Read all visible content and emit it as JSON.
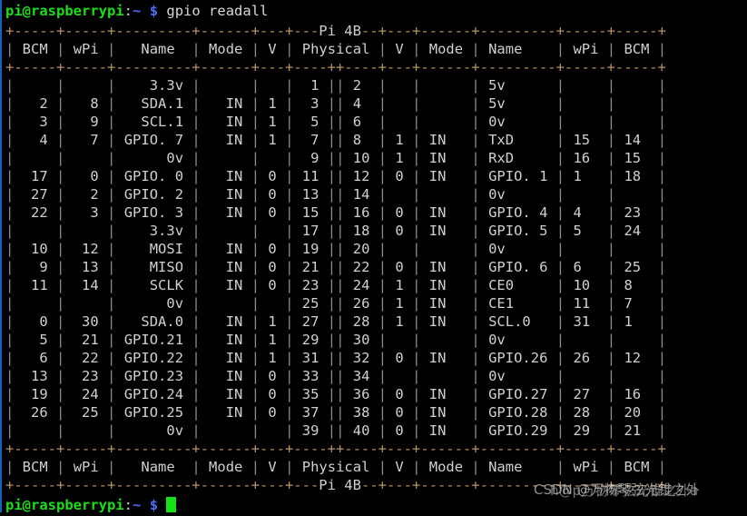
{
  "terminal": {
    "prompt": {
      "user_host": "pi@raspberrypi",
      "colon": ":",
      "path": "~",
      "dollar": "$"
    },
    "command": "gpio readall",
    "watermark": "CSDN @万物琴弦光锥之外",
    "watermark_overlay": "h@p万物琴弦光锥之外a"
  },
  "table": {
    "board_label": "Pi 4B",
    "border_top": "+-----+-----+---------+------+---+---Pi 4B--+---+------+---------+-----+-----+",
    "border_mid": "+-----+-----+---------+------+---+----++----+---+------+---------+-----+-----+",
    "border_bottom": "+-----+-----+---------+------+---+---Pi 4B--+---+------+---------+-----+-----+",
    "header_line": "| BCM | wPi |   Name  | Mode | V | Physical | V | Mode | Name    | wPi | BCM |",
    "headers": [
      "BCM",
      "wPi",
      "Name",
      "Mode",
      "V",
      "Physical",
      "V",
      "Mode",
      "Name",
      "wPi",
      "BCM"
    ],
    "rows": [
      {
        "bcm_l": "",
        "wpi_l": "",
        "name_l": "3.3v",
        "mode_l": "",
        "v_l": "",
        "phys_l": "1",
        "phys_r": "2",
        "v_r": "",
        "mode_r": "",
        "name_r": "5v",
        "wpi_r": "",
        "bcm_r": ""
      },
      {
        "bcm_l": "2",
        "wpi_l": "8",
        "name_l": "SDA.1",
        "mode_l": "IN",
        "v_l": "1",
        "phys_l": "3",
        "phys_r": "4",
        "v_r": "",
        "mode_r": "",
        "name_r": "5v",
        "wpi_r": "",
        "bcm_r": ""
      },
      {
        "bcm_l": "3",
        "wpi_l": "9",
        "name_l": "SCL.1",
        "mode_l": "IN",
        "v_l": "1",
        "phys_l": "5",
        "phys_r": "6",
        "v_r": "",
        "mode_r": "",
        "name_r": "0v",
        "wpi_r": "",
        "bcm_r": ""
      },
      {
        "bcm_l": "4",
        "wpi_l": "7",
        "name_l": "GPIO. 7",
        "mode_l": "IN",
        "v_l": "1",
        "phys_l": "7",
        "phys_r": "8",
        "v_r": "1",
        "mode_r": "IN",
        "name_r": "TxD",
        "wpi_r": "15",
        "bcm_r": "14"
      },
      {
        "bcm_l": "",
        "wpi_l": "",
        "name_l": "0v",
        "mode_l": "",
        "v_l": "",
        "phys_l": "9",
        "phys_r": "10",
        "v_r": "1",
        "mode_r": "IN",
        "name_r": "RxD",
        "wpi_r": "16",
        "bcm_r": "15"
      },
      {
        "bcm_l": "17",
        "wpi_l": "0",
        "name_l": "GPIO. 0",
        "mode_l": "IN",
        "v_l": "0",
        "phys_l": "11",
        "phys_r": "12",
        "v_r": "0",
        "mode_r": "IN",
        "name_r": "GPIO. 1",
        "wpi_r": "1",
        "bcm_r": "18"
      },
      {
        "bcm_l": "27",
        "wpi_l": "2",
        "name_l": "GPIO. 2",
        "mode_l": "IN",
        "v_l": "0",
        "phys_l": "13",
        "phys_r": "14",
        "v_r": "",
        "mode_r": "",
        "name_r": "0v",
        "wpi_r": "",
        "bcm_r": ""
      },
      {
        "bcm_l": "22",
        "wpi_l": "3",
        "name_l": "GPIO. 3",
        "mode_l": "IN",
        "v_l": "0",
        "phys_l": "15",
        "phys_r": "16",
        "v_r": "0",
        "mode_r": "IN",
        "name_r": "GPIO. 4",
        "wpi_r": "4",
        "bcm_r": "23"
      },
      {
        "bcm_l": "",
        "wpi_l": "",
        "name_l": "3.3v",
        "mode_l": "",
        "v_l": "",
        "phys_l": "17",
        "phys_r": "18",
        "v_r": "0",
        "mode_r": "IN",
        "name_r": "GPIO. 5",
        "wpi_r": "5",
        "bcm_r": "24"
      },
      {
        "bcm_l": "10",
        "wpi_l": "12",
        "name_l": "MOSI",
        "mode_l": "IN",
        "v_l": "0",
        "phys_l": "19",
        "phys_r": "20",
        "v_r": "",
        "mode_r": "",
        "name_r": "0v",
        "wpi_r": "",
        "bcm_r": ""
      },
      {
        "bcm_l": "9",
        "wpi_l": "13",
        "name_l": "MISO",
        "mode_l": "IN",
        "v_l": "0",
        "phys_l": "21",
        "phys_r": "22",
        "v_r": "0",
        "mode_r": "IN",
        "name_r": "GPIO. 6",
        "wpi_r": "6",
        "bcm_r": "25"
      },
      {
        "bcm_l": "11",
        "wpi_l": "14",
        "name_l": "SCLK",
        "mode_l": "IN",
        "v_l": "0",
        "phys_l": "23",
        "phys_r": "24",
        "v_r": "1",
        "mode_r": "IN",
        "name_r": "CE0",
        "wpi_r": "10",
        "bcm_r": "8"
      },
      {
        "bcm_l": "",
        "wpi_l": "",
        "name_l": "0v",
        "mode_l": "",
        "v_l": "",
        "phys_l": "25",
        "phys_r": "26",
        "v_r": "1",
        "mode_r": "IN",
        "name_r": "CE1",
        "wpi_r": "11",
        "bcm_r": "7"
      },
      {
        "bcm_l": "0",
        "wpi_l": "30",
        "name_l": "SDA.0",
        "mode_l": "IN",
        "v_l": "1",
        "phys_l": "27",
        "phys_r": "28",
        "v_r": "1",
        "mode_r": "IN",
        "name_r": "SCL.0",
        "wpi_r": "31",
        "bcm_r": "1"
      },
      {
        "bcm_l": "5",
        "wpi_l": "21",
        "name_l": "GPIO.21",
        "mode_l": "IN",
        "v_l": "1",
        "phys_l": "29",
        "phys_r": "30",
        "v_r": "",
        "mode_r": "",
        "name_r": "0v",
        "wpi_r": "",
        "bcm_r": ""
      },
      {
        "bcm_l": "6",
        "wpi_l": "22",
        "name_l": "GPIO.22",
        "mode_l": "IN",
        "v_l": "1",
        "phys_l": "31",
        "phys_r": "32",
        "v_r": "0",
        "mode_r": "IN",
        "name_r": "GPIO.26",
        "wpi_r": "26",
        "bcm_r": "12"
      },
      {
        "bcm_l": "13",
        "wpi_l": "23",
        "name_l": "GPIO.23",
        "mode_l": "IN",
        "v_l": "0",
        "phys_l": "33",
        "phys_r": "34",
        "v_r": "",
        "mode_r": "",
        "name_r": "0v",
        "wpi_r": "",
        "bcm_r": ""
      },
      {
        "bcm_l": "19",
        "wpi_l": "24",
        "name_l": "GPIO.24",
        "mode_l": "IN",
        "v_l": "0",
        "phys_l": "35",
        "phys_r": "36",
        "v_r": "0",
        "mode_r": "IN",
        "name_r": "GPIO.27",
        "wpi_r": "27",
        "bcm_r": "16"
      },
      {
        "bcm_l": "26",
        "wpi_l": "25",
        "name_l": "GPIO.25",
        "mode_l": "IN",
        "v_l": "0",
        "phys_l": "37",
        "phys_r": "38",
        "v_r": "0",
        "mode_r": "IN",
        "name_r": "GPIO.28",
        "wpi_r": "28",
        "bcm_r": "20"
      },
      {
        "bcm_l": "",
        "wpi_l": "",
        "name_l": "0v",
        "mode_l": "",
        "v_l": "",
        "phys_l": "39",
        "phys_r": "40",
        "v_r": "0",
        "mode_r": "IN",
        "name_r": "GPIO.29",
        "wpi_r": "29",
        "bcm_r": "21"
      }
    ]
  }
}
